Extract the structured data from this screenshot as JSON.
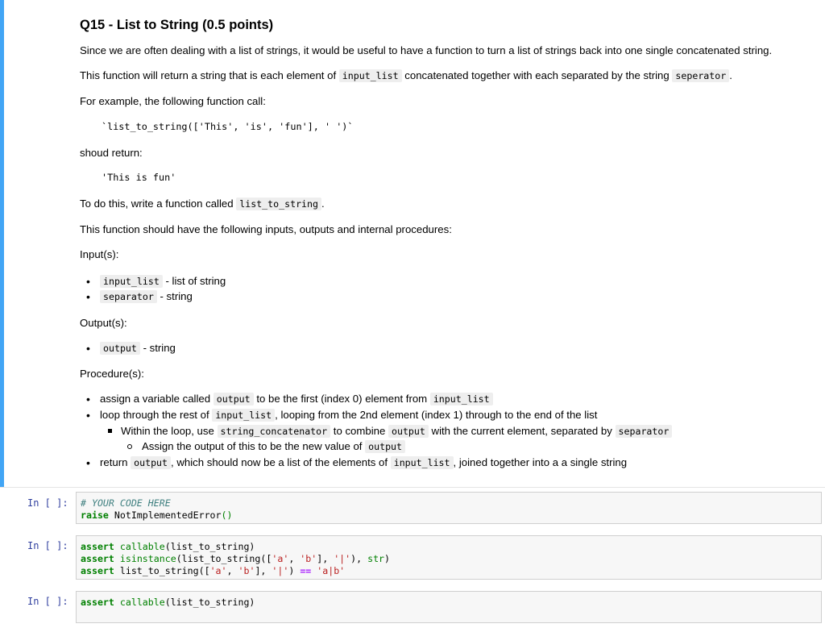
{
  "markdown": {
    "title": "Q15 - List to String (0.5 points)",
    "intro": "Since we are often dealing with a list of strings, it would be useful to have a function to turn a list of strings back into one single concatenated string.",
    "returns_desc": {
      "p1": "This function will return a string that is each element of",
      "c1": "input_list",
      "p2": "concatenated together with each separated by the string",
      "c2": "seperator",
      "p3": "."
    },
    "example_label": "For example, the following function call:",
    "example_call": "`list_to_string(['This', 'is', 'fun'], ' ')`",
    "should_return": "shoud return:",
    "example_result": "'This is fun'",
    "todo": {
      "p1": "To do this, write a function called",
      "c1": "list_to_string",
      "p2": "."
    },
    "spec_intro": "This function should have the following inputs, outputs and internal procedures:",
    "inputs_label": "Input(s):",
    "inputs": [
      {
        "code": "input_list",
        "desc": "- list of string"
      },
      {
        "code": "separator",
        "desc": "- string"
      }
    ],
    "outputs_label": "Output(s):",
    "outputs": [
      {
        "code": "output",
        "desc": "- string"
      }
    ],
    "procedure_label": "Procedure(s):",
    "procedure": {
      "s1": {
        "p1": "assign a variable called",
        "c1": "output",
        "p2": "to be the first (index 0) element from",
        "c2": "input_list"
      },
      "s2": {
        "p1": "loop through the rest of",
        "c1": "input_list",
        "p2": ", looping from the 2nd element (index 1) through to the end of the list"
      },
      "s3": {
        "p1": "Within the loop, use",
        "c1": "string_concatenator",
        "p2": "to combine",
        "c2": "output",
        "p3": "with the current element, separated by",
        "c3": "separator"
      },
      "s4": {
        "p1": "Assign the output of this to be the new value of",
        "c1": "output"
      },
      "s5": {
        "p1": "return",
        "c1": "output",
        "p2": ", which should now be a list of the elements of",
        "c2": "input_list",
        "p3": ", joined together into a a single string"
      }
    }
  },
  "cells": [
    {
      "prompt": "In [ ]:",
      "lines": [
        [
          {
            "t": "# YOUR CODE HERE",
            "c": "cm"
          }
        ],
        [
          {
            "t": "raise",
            "c": "kw"
          },
          {
            "t": " NotImplementedError",
            "c": ""
          },
          {
            "t": "()",
            "c": "pn"
          }
        ]
      ]
    },
    {
      "prompt": "In [ ]:",
      "lines": [
        [
          {
            "t": "assert",
            "c": "kw"
          },
          {
            "t": " ",
            "c": ""
          },
          {
            "t": "callable",
            "c": "bi"
          },
          {
            "t": "(list_to_string)",
            "c": ""
          }
        ],
        [
          {
            "t": "assert",
            "c": "kw"
          },
          {
            "t": " ",
            "c": ""
          },
          {
            "t": "isinstance",
            "c": "bi"
          },
          {
            "t": "(list_to_string([",
            "c": ""
          },
          {
            "t": "'a'",
            "c": "st"
          },
          {
            "t": ", ",
            "c": ""
          },
          {
            "t": "'b'",
            "c": "st"
          },
          {
            "t": "], ",
            "c": ""
          },
          {
            "t": "'|'",
            "c": "st"
          },
          {
            "t": "), ",
            "c": ""
          },
          {
            "t": "str",
            "c": "bi"
          },
          {
            "t": ")",
            "c": ""
          }
        ],
        [
          {
            "t": "assert",
            "c": "kw"
          },
          {
            "t": " list_to_string([",
            "c": ""
          },
          {
            "t": "'a'",
            "c": "st"
          },
          {
            "t": ", ",
            "c": ""
          },
          {
            "t": "'b'",
            "c": "st"
          },
          {
            "t": "], ",
            "c": ""
          },
          {
            "t": "'|'",
            "c": "st"
          },
          {
            "t": ") ",
            "c": ""
          },
          {
            "t": "==",
            "c": "op"
          },
          {
            "t": " ",
            "c": ""
          },
          {
            "t": "'a|b'",
            "c": "st"
          }
        ]
      ]
    },
    {
      "prompt": "In [ ]:",
      "lines": [
        [
          {
            "t": "assert",
            "c": "kw"
          },
          {
            "t": " ",
            "c": ""
          },
          {
            "t": "callable",
            "c": "bi"
          },
          {
            "t": "(list_to_string)",
            "c": ""
          }
        ]
      ]
    }
  ]
}
